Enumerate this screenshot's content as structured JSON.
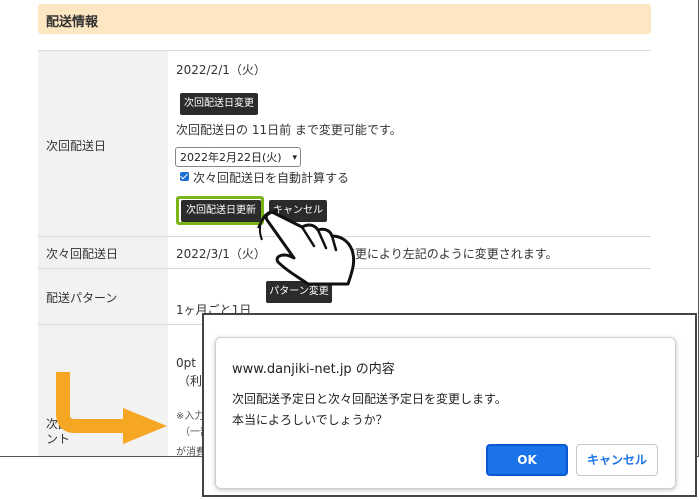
{
  "section": {
    "title": "配送情報"
  },
  "rows": {
    "next_delivery": {
      "label": "次回配送日",
      "current_date": "2022/2/1（火）",
      "change_button": "次回配送日変更",
      "change_note": "次回配送日の 11日前 まで変更可能です。",
      "date_select_value": "2022年2月22日(火)",
      "auto_calc_label": "次々回配送日を自動計算する",
      "update_button": "次回配送日更新",
      "cancel_button": "キャンセル"
    },
    "next_next_delivery": {
      "label": "次々回配送日",
      "value": "2022/3/1（火）",
      "note": "変更により左記のように変更されます。"
    },
    "delivery_pattern": {
      "label": "配送パターン",
      "change_button": "パターン変更",
      "value": "1ヶ月ごと1日"
    },
    "points": {
      "label_line1": "次回",
      "label_line2": "ント",
      "value": "0pt",
      "value_sub": "（利",
      "note1": "※入力",
      "note2": "（一部",
      "note3": "が消費"
    }
  },
  "dialog": {
    "origin": "www.danjiki-net.jp の内容",
    "message_line1": "次回配送予定日と次々回配送予定日を変更します。",
    "message_line2": "本当によろしいでしょうか？",
    "ok_label": "OK",
    "cancel_label": "キャンセル"
  },
  "colors": {
    "section_header_bg": "#fde7c2",
    "highlight_border": "#7ab317",
    "ok_button": "#1a73e8",
    "arrow": "#f5a623"
  },
  "icons": {
    "pointer": "hand-pointer-icon",
    "arrow": "curved-arrow-icon",
    "checkbox": "checked-checkbox-icon",
    "select": "chevron-down-icon"
  }
}
